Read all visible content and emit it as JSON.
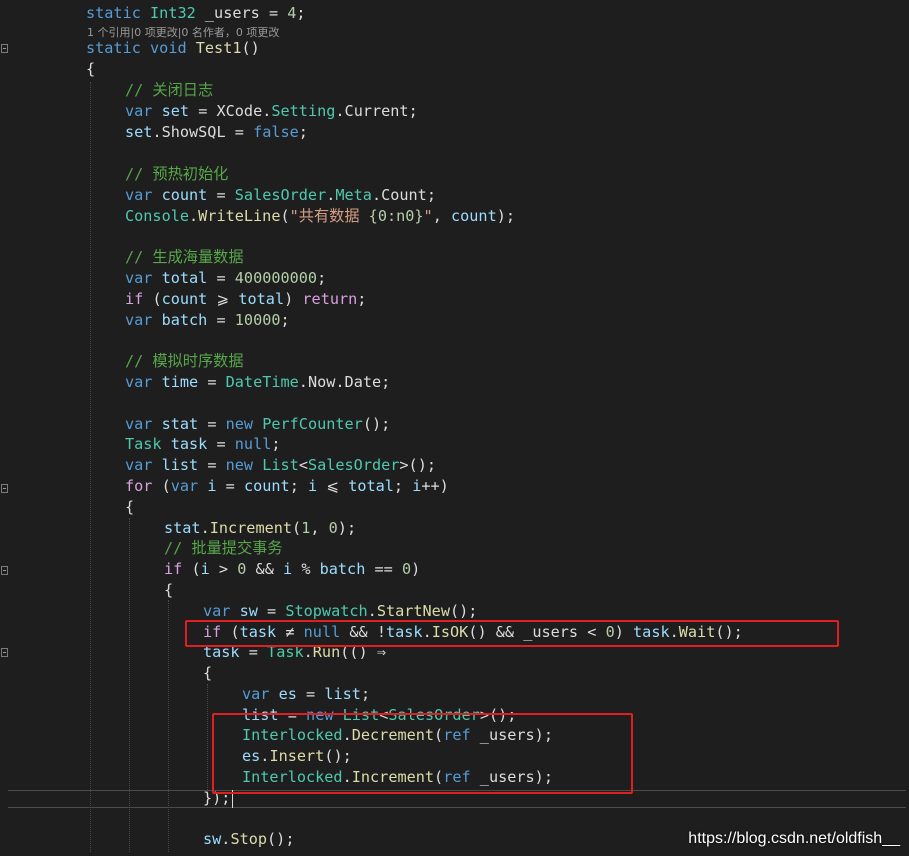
{
  "code": {
    "l01": {
      "a": "static",
      "b": "Int32",
      "c": "_users",
      "d": "=",
      "e": "4",
      "f": ";"
    },
    "lens": "1 个引用|0 项更改|0 名作者，0 项更改",
    "l02": {
      "a": "static",
      "b": "void",
      "c": "Test1",
      "d": "()"
    },
    "l03": "{",
    "l04": "// 关闭日志",
    "l05": {
      "a": "var",
      "b": "set",
      "c": "=",
      "d": "XCode",
      "e": ".",
      "f": "Setting",
      "g": ".",
      "h": "Current",
      "i": ";"
    },
    "l06": {
      "a": "set",
      "b": ".",
      "c": "ShowSQL",
      "d": "=",
      "e": "false",
      "f": ";"
    },
    "l07": "// 预热初始化",
    "l08": {
      "a": "var",
      "b": "count",
      "c": "=",
      "d": "SalesOrder",
      "e": ".",
      "f": "Meta",
      "g": ".",
      "h": "Count",
      "i": ";"
    },
    "l09": {
      "a": "Console",
      "b": ".",
      "c": "WriteLine",
      "d": "(",
      "e": "\"共有数据 ",
      "f": "{0:n0}",
      "g": "\"",
      "h": ", ",
      "i": "count",
      "j": ");"
    },
    "l10": "// 生成海量数据",
    "l11": {
      "a": "var",
      "b": "total",
      "c": "=",
      "d": "400000000",
      "e": ";"
    },
    "l12": {
      "a": "if",
      "b": "(",
      "c": "count",
      "d": "⩾",
      "e": "total",
      "f": ")",
      "g": "return",
      "h": ";"
    },
    "l13": {
      "a": "var",
      "b": "batch",
      "c": "=",
      "d": "10000",
      "e": ";"
    },
    "l14": "// 模拟时序数据",
    "l15": {
      "a": "var",
      "b": "time",
      "c": "=",
      "d": "DateTime",
      "e": ".",
      "f": "Now",
      "g": ".",
      "h": "Date",
      "i": ";"
    },
    "l16": {
      "a": "var",
      "b": "stat",
      "c": "=",
      "d": "new",
      "e": "PerfCounter",
      "f": "();"
    },
    "l17": {
      "a": "Task",
      "b": "task",
      "c": "=",
      "d": "null",
      "e": ";"
    },
    "l18": {
      "a": "var",
      "b": "list",
      "c": "=",
      "d": "new",
      "e": "List",
      "f": "<",
      "g": "SalesOrder",
      "h": ">();"
    },
    "l19": {
      "a": "for",
      "b": "(",
      "c": "var",
      "d": "i",
      "e": "=",
      "f": "count",
      "g": ";",
      "h": "i",
      "i": "⩽",
      "j": "total",
      "k": ";",
      "l": "i",
      "m": "++)"
    },
    "l20": "{",
    "l21": {
      "a": "stat",
      "b": ".",
      "c": "Increment",
      "d": "(",
      "e": "1",
      "f": ", ",
      "g": "0",
      "h": ");"
    },
    "l22": "// 批量提交事务",
    "l23": {
      "a": "if",
      "b": "(",
      "c": "i",
      "d": ">",
      "e": "0",
      "f": "&&",
      "g": "i",
      "h": "%",
      "i": "batch",
      "j": "==",
      "k": "0",
      "l": ")"
    },
    "l24": "{",
    "l25": {
      "a": "var",
      "b": "sw",
      "c": "=",
      "d": "Stopwatch",
      "e": ".",
      "f": "StartNew",
      "g": "();"
    },
    "l26": {
      "a": "if",
      "b": "(",
      "c": "task",
      "d": "≠",
      "e": "null",
      "f": "&&",
      "g": "!",
      "h": "task",
      "i": ".",
      "j": "IsOK",
      "k": "()",
      "l": "&&",
      "m": "_users",
      "n": "<",
      "o": "0",
      "p": ")",
      "q": "task",
      "r": ".",
      "s": "Wait",
      "t": "();"
    },
    "l27": {
      "a": "task",
      "b": "=",
      "c": "Task",
      "d": ".",
      "e": "Run",
      "f": "(()",
      "g": "⇒"
    },
    "l28": "{",
    "l29": {
      "a": "var",
      "b": "es",
      "c": "=",
      "d": "list",
      "e": ";"
    },
    "l30": {
      "a": "list",
      "b": "=",
      "c": "new",
      "d": "List",
      "e": "<",
      "f": "SalesOrder",
      "g": ">();"
    },
    "l31": {
      "a": "Interlocked",
      "b": ".",
      "c": "Decrement",
      "d": "(",
      "e": "ref",
      "f": "_users",
      "g": ");"
    },
    "l32": {
      "a": "es",
      "b": ".",
      "c": "Insert",
      "d": "();"
    },
    "l33": {
      "a": "Interlocked",
      "b": ".",
      "c": "Increment",
      "d": "(",
      "e": "ref",
      "f": "_users",
      "g": ");"
    },
    "l34": "});",
    "l35": {
      "a": "sw",
      "b": ".",
      "c": "Stop",
      "d": "();"
    }
  },
  "watermark": "https://blog.csdn.net/oldfish__",
  "colors": {
    "background": "#1e1e1e",
    "keyword": "#569cd6",
    "control_keyword": "#d8a0df",
    "type": "#4ec9b0",
    "local_variable": "#9cdcfe",
    "number": "#b5cea8",
    "string": "#d69d85",
    "comment": "#57a64a",
    "method": "#dcdcaa",
    "highlight_box": "#e02020"
  }
}
